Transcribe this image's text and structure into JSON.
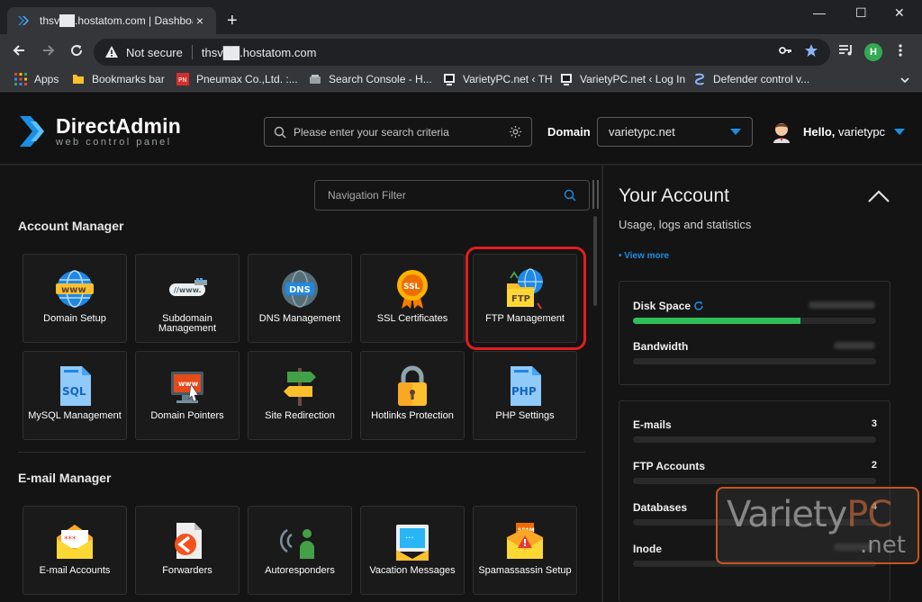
{
  "browser": {
    "tab_title": "thsv██.hostatom.com | Dashboard",
    "tab_close": "×",
    "new_tab": "+",
    "not_secure": "Not secure",
    "url": "thsv██.hostatom.com",
    "profile_initial": "H",
    "window": {
      "minimize": "—",
      "maximize": "☐",
      "close": "✕"
    },
    "bookmarks": [
      {
        "label": "Apps",
        "icon": "apps-grid-icon"
      },
      {
        "label": "Bookmarks bar",
        "icon": "folder-icon"
      },
      {
        "label": "Pneumax Co.,Ltd. :...",
        "icon": "pneumax-icon"
      },
      {
        "label": "Search Console - H...",
        "icon": "search-console-icon"
      },
      {
        "label": "VarietyPC.net ‹ TH",
        "icon": "varietypc-icon"
      },
      {
        "label": "VarietyPC.net ‹ Log In",
        "icon": "varietypc-icon"
      },
      {
        "label": "Defender control v...",
        "icon": "defender-icon"
      }
    ]
  },
  "header": {
    "logo_title": "DirectAdmin",
    "logo_subtitle": "web control panel",
    "search_placeholder": "Please enter your search criteria",
    "domain_label": "Domain",
    "domain_value": "varietypc.net",
    "greeting": "Hello,",
    "username": "varietypc"
  },
  "main": {
    "nav_filter_placeholder": "Navigation Filter",
    "account_manager": {
      "title": "Account Manager",
      "tiles": [
        {
          "label": "Domain Setup",
          "icon": "www-globe-icon"
        },
        {
          "label": "Subdomain Management",
          "icon": "subdomain-icon"
        },
        {
          "label": "DNS Management",
          "icon": "dns-icon"
        },
        {
          "label": "SSL Certificates",
          "icon": "ssl-badge-icon"
        },
        {
          "label": "FTP Management",
          "icon": "ftp-folder-icon"
        },
        {
          "label": "MySQL Management",
          "icon": "sql-document-icon"
        },
        {
          "label": "Domain Pointers",
          "icon": "domain-pointer-icon"
        },
        {
          "label": "Site Redirection",
          "icon": "signpost-icon"
        },
        {
          "label": "Hotlinks Protection",
          "icon": "padlock-icon"
        },
        {
          "label": "PHP Settings",
          "icon": "php-document-icon"
        }
      ]
    },
    "email_manager": {
      "title": "E-mail Manager",
      "tiles": [
        {
          "label": "E-mail Accounts",
          "icon": "envelope-icon"
        },
        {
          "label": "Forwarders",
          "icon": "forward-document-icon"
        },
        {
          "label": "Autoresponders",
          "icon": "autoresponder-icon"
        },
        {
          "label": "Vacation Messages",
          "icon": "vacation-message-icon"
        },
        {
          "label": "Spamassassin Setup",
          "icon": "spam-envelope-icon"
        }
      ]
    }
  },
  "account": {
    "title": "Your Account",
    "subtitle": "Usage, logs and statistics",
    "view_more": "• View more",
    "disk_space": {
      "label": "Disk Space",
      "progress": 0.69
    },
    "bandwidth": {
      "label": "Bandwidth",
      "progress": 0
    },
    "counts": [
      {
        "label": "E-mails",
        "value": "3"
      },
      {
        "label": "FTP Accounts",
        "value": "2"
      },
      {
        "label": "Databases",
        "value": "4"
      },
      {
        "label": "Inode",
        "value": ""
      }
    ]
  },
  "watermark": {
    "brand_main": "Variety",
    "brand_accent": "PC",
    "brand_suffix": ".net"
  },
  "colors": {
    "accent": "#1a8fe3",
    "highlight": "#e01e1e",
    "progress": "#2fbf5a",
    "background": "#141414"
  }
}
